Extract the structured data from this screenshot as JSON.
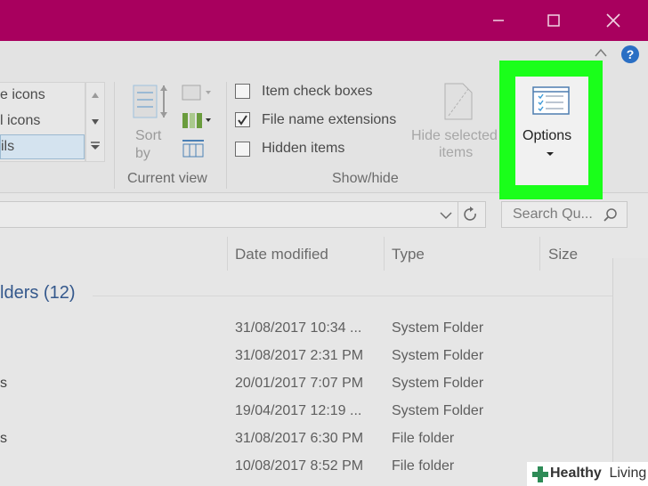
{
  "ribbon": {
    "layout_items": [
      {
        "label": "e icons",
        "selected": false
      },
      {
        "label": "l icons",
        "selected": false
      },
      {
        "label": "ils",
        "selected": true
      }
    ],
    "sort_label_1": "Sort",
    "sort_label_2": "by",
    "current_view_label": "Current view",
    "show_hide": {
      "item_check_boxes": {
        "label": "Item check boxes",
        "checked": false
      },
      "file_name_extensions": {
        "label": "File name extensions",
        "checked": true
      },
      "hidden_items": {
        "label": "Hidden items",
        "checked": false
      }
    },
    "show_hide_label": "Show/hide",
    "hide_selected_1": "Hide selected",
    "hide_selected_2": "items",
    "options_label": "Options",
    "help_glyph": "?"
  },
  "search": {
    "placeholder": "Search Qu..."
  },
  "columns": {
    "date": "Date modified",
    "type": "Type",
    "size": "Size"
  },
  "group_header": "lders (12)",
  "rows": [
    {
      "stub": "",
      "date": "31/08/2017 10:34 ...",
      "type": "System Folder"
    },
    {
      "stub": "",
      "date": "31/08/2017 2:31 PM",
      "type": "System Folder"
    },
    {
      "stub": "s",
      "date": "20/01/2017 7:07 PM",
      "type": "System Folder"
    },
    {
      "stub": "",
      "date": "19/04/2017 12:19 ...",
      "type": "System Folder"
    },
    {
      "stub": "s",
      "date": "31/08/2017 6:30 PM",
      "type": "File folder"
    },
    {
      "stub": "",
      "date": "10/08/2017 8:52 PM",
      "type": "File folder"
    }
  ],
  "watermark": {
    "brand_1": "Healthy",
    "brand_2": " Living"
  },
  "colors": {
    "titlebar": "#a8005e",
    "highlight": "#1aff1a",
    "group_header": "#34588c"
  },
  "icons": [
    "close-icon",
    "maximize-icon",
    "minimize-icon",
    "options-icon",
    "sort-icon",
    "help-icon",
    "refresh-icon",
    "search-icon"
  ]
}
